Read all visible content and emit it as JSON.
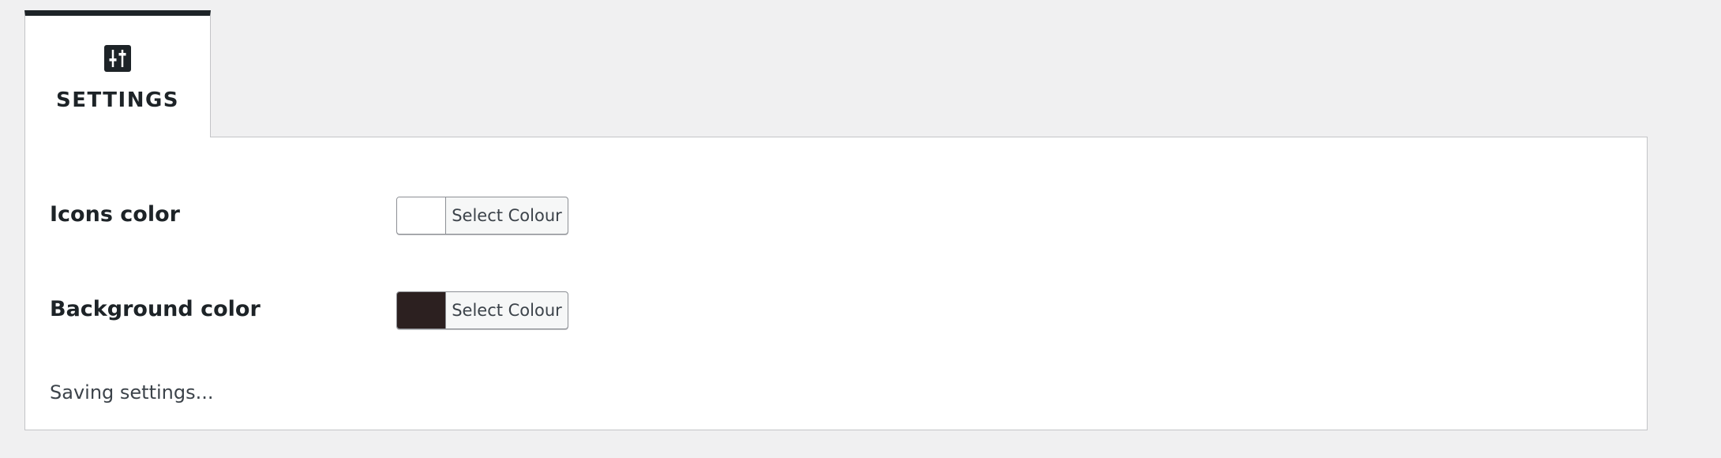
{
  "tab": {
    "label": "SETTINGS",
    "icon": "sliders-icon"
  },
  "settings": {
    "icons_color": {
      "label": "Icons color",
      "button_label": "Select Colour",
      "value": "#ffffff"
    },
    "background_color": {
      "label": "Background color",
      "button_label": "Select Colour",
      "value": "#2c2020"
    }
  },
  "status": {
    "text": "Saving settings..."
  },
  "colors": {
    "accent": "#1d2327",
    "page_background": "#f0f0f1",
    "panel_background": "#ffffff"
  }
}
